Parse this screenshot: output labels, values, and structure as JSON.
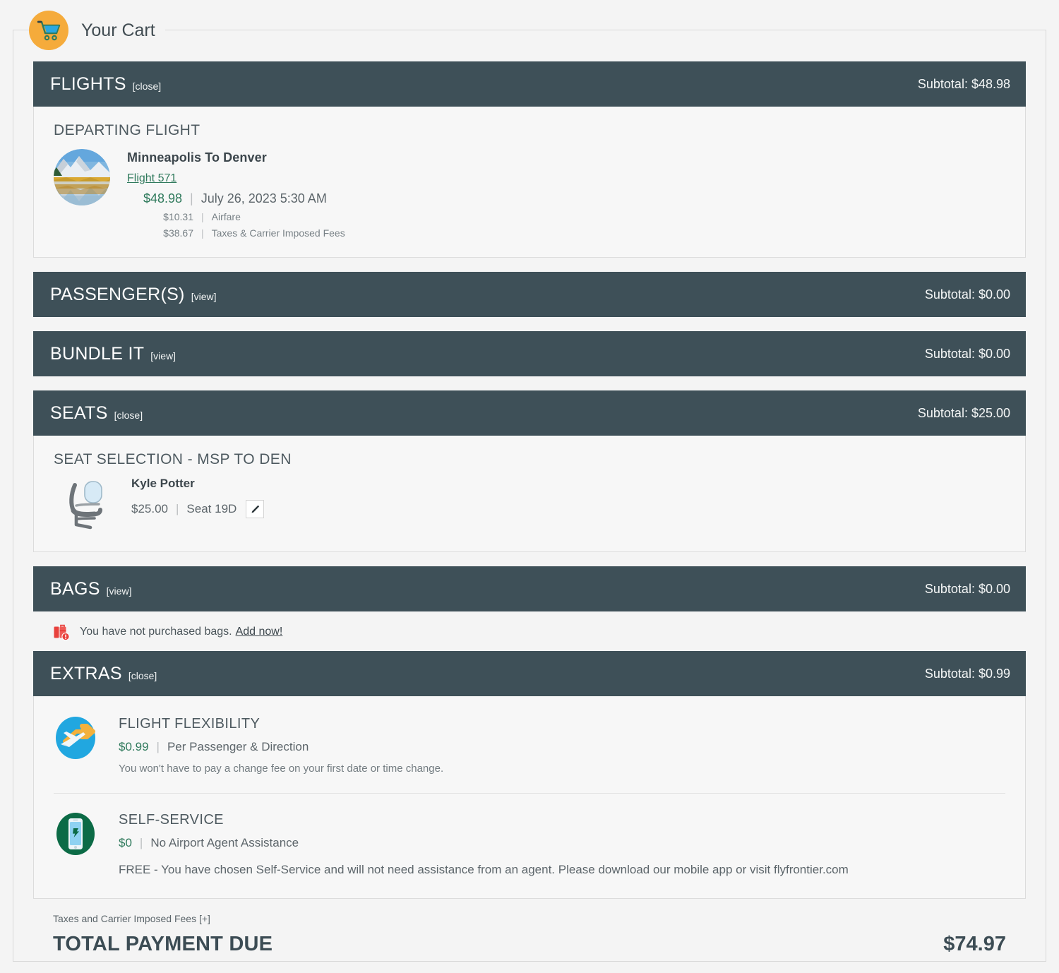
{
  "header": {
    "title": "Your Cart",
    "icon": "shopping-cart-icon"
  },
  "colors": {
    "section_header_bg": "#3e5058",
    "accent_green": "#2f7a5c",
    "cart_badge": "#f5ab3b",
    "alert_red": "#e8413c",
    "page_bg": "#f4f4f4"
  },
  "sections": {
    "flights": {
      "title": "FLIGHTS",
      "toggle": "[close]",
      "subtotal": "Subtotal: $48.98",
      "panel_title": "DEPARTING  FLIGHT",
      "route": "Minneapolis To Denver",
      "flight_number": "Flight 571",
      "price": "$48.98",
      "datetime": "July 26, 2023 5:30 AM",
      "airfare_amount": "$10.31",
      "airfare_label": "Airfare",
      "taxes_amount": "$38.67",
      "taxes_label": "Taxes & Carrier Imposed Fees"
    },
    "passengers": {
      "title": "PASSENGER(S)",
      "toggle": "[view]",
      "subtotal": "Subtotal: $0.00"
    },
    "bundle": {
      "title": "BUNDLE IT",
      "toggle": "[view]",
      "subtotal": "Subtotal: $0.00"
    },
    "seats": {
      "title": "SEATS",
      "toggle": "[close]",
      "subtotal": "Subtotal: $25.00",
      "panel_title": "SEAT SELECTION - MSP TO DEN",
      "passenger_name": "Kyle Potter",
      "price": "$25.00",
      "seat_label": "Seat 19D",
      "edit_icon": "pencil-icon"
    },
    "bags": {
      "title": "BAGS",
      "toggle": "[view]",
      "subtotal": "Subtotal: $0.00",
      "notice_text": "You have not purchased bags.",
      "notice_link": "Add now!"
    },
    "extras": {
      "title": "EXTRAS",
      "toggle": "[close]",
      "subtotal": "Subtotal: $0.99",
      "items": [
        {
          "name": "FLIGHT FLEXIBILITY",
          "price": "$0.99",
          "qualifier": "Per Passenger & Direction",
          "description": "You won't have to pay a change fee on your first date or time change.",
          "icon": "plane-flexibility-icon"
        },
        {
          "name": "SELF-SERVICE",
          "price": "$0",
          "qualifier": "No Airport Agent Assistance",
          "description": "FREE - You have chosen Self-Service and will not need assistance from an agent. Please download our mobile app or visit flyfrontier.com",
          "icon": "mobile-phone-icon"
        }
      ]
    }
  },
  "footer": {
    "taxes_note": "Taxes and Carrier Imposed Fees [+]",
    "total_label": "TOTAL PAYMENT DUE",
    "total_amount": "$74.97"
  }
}
